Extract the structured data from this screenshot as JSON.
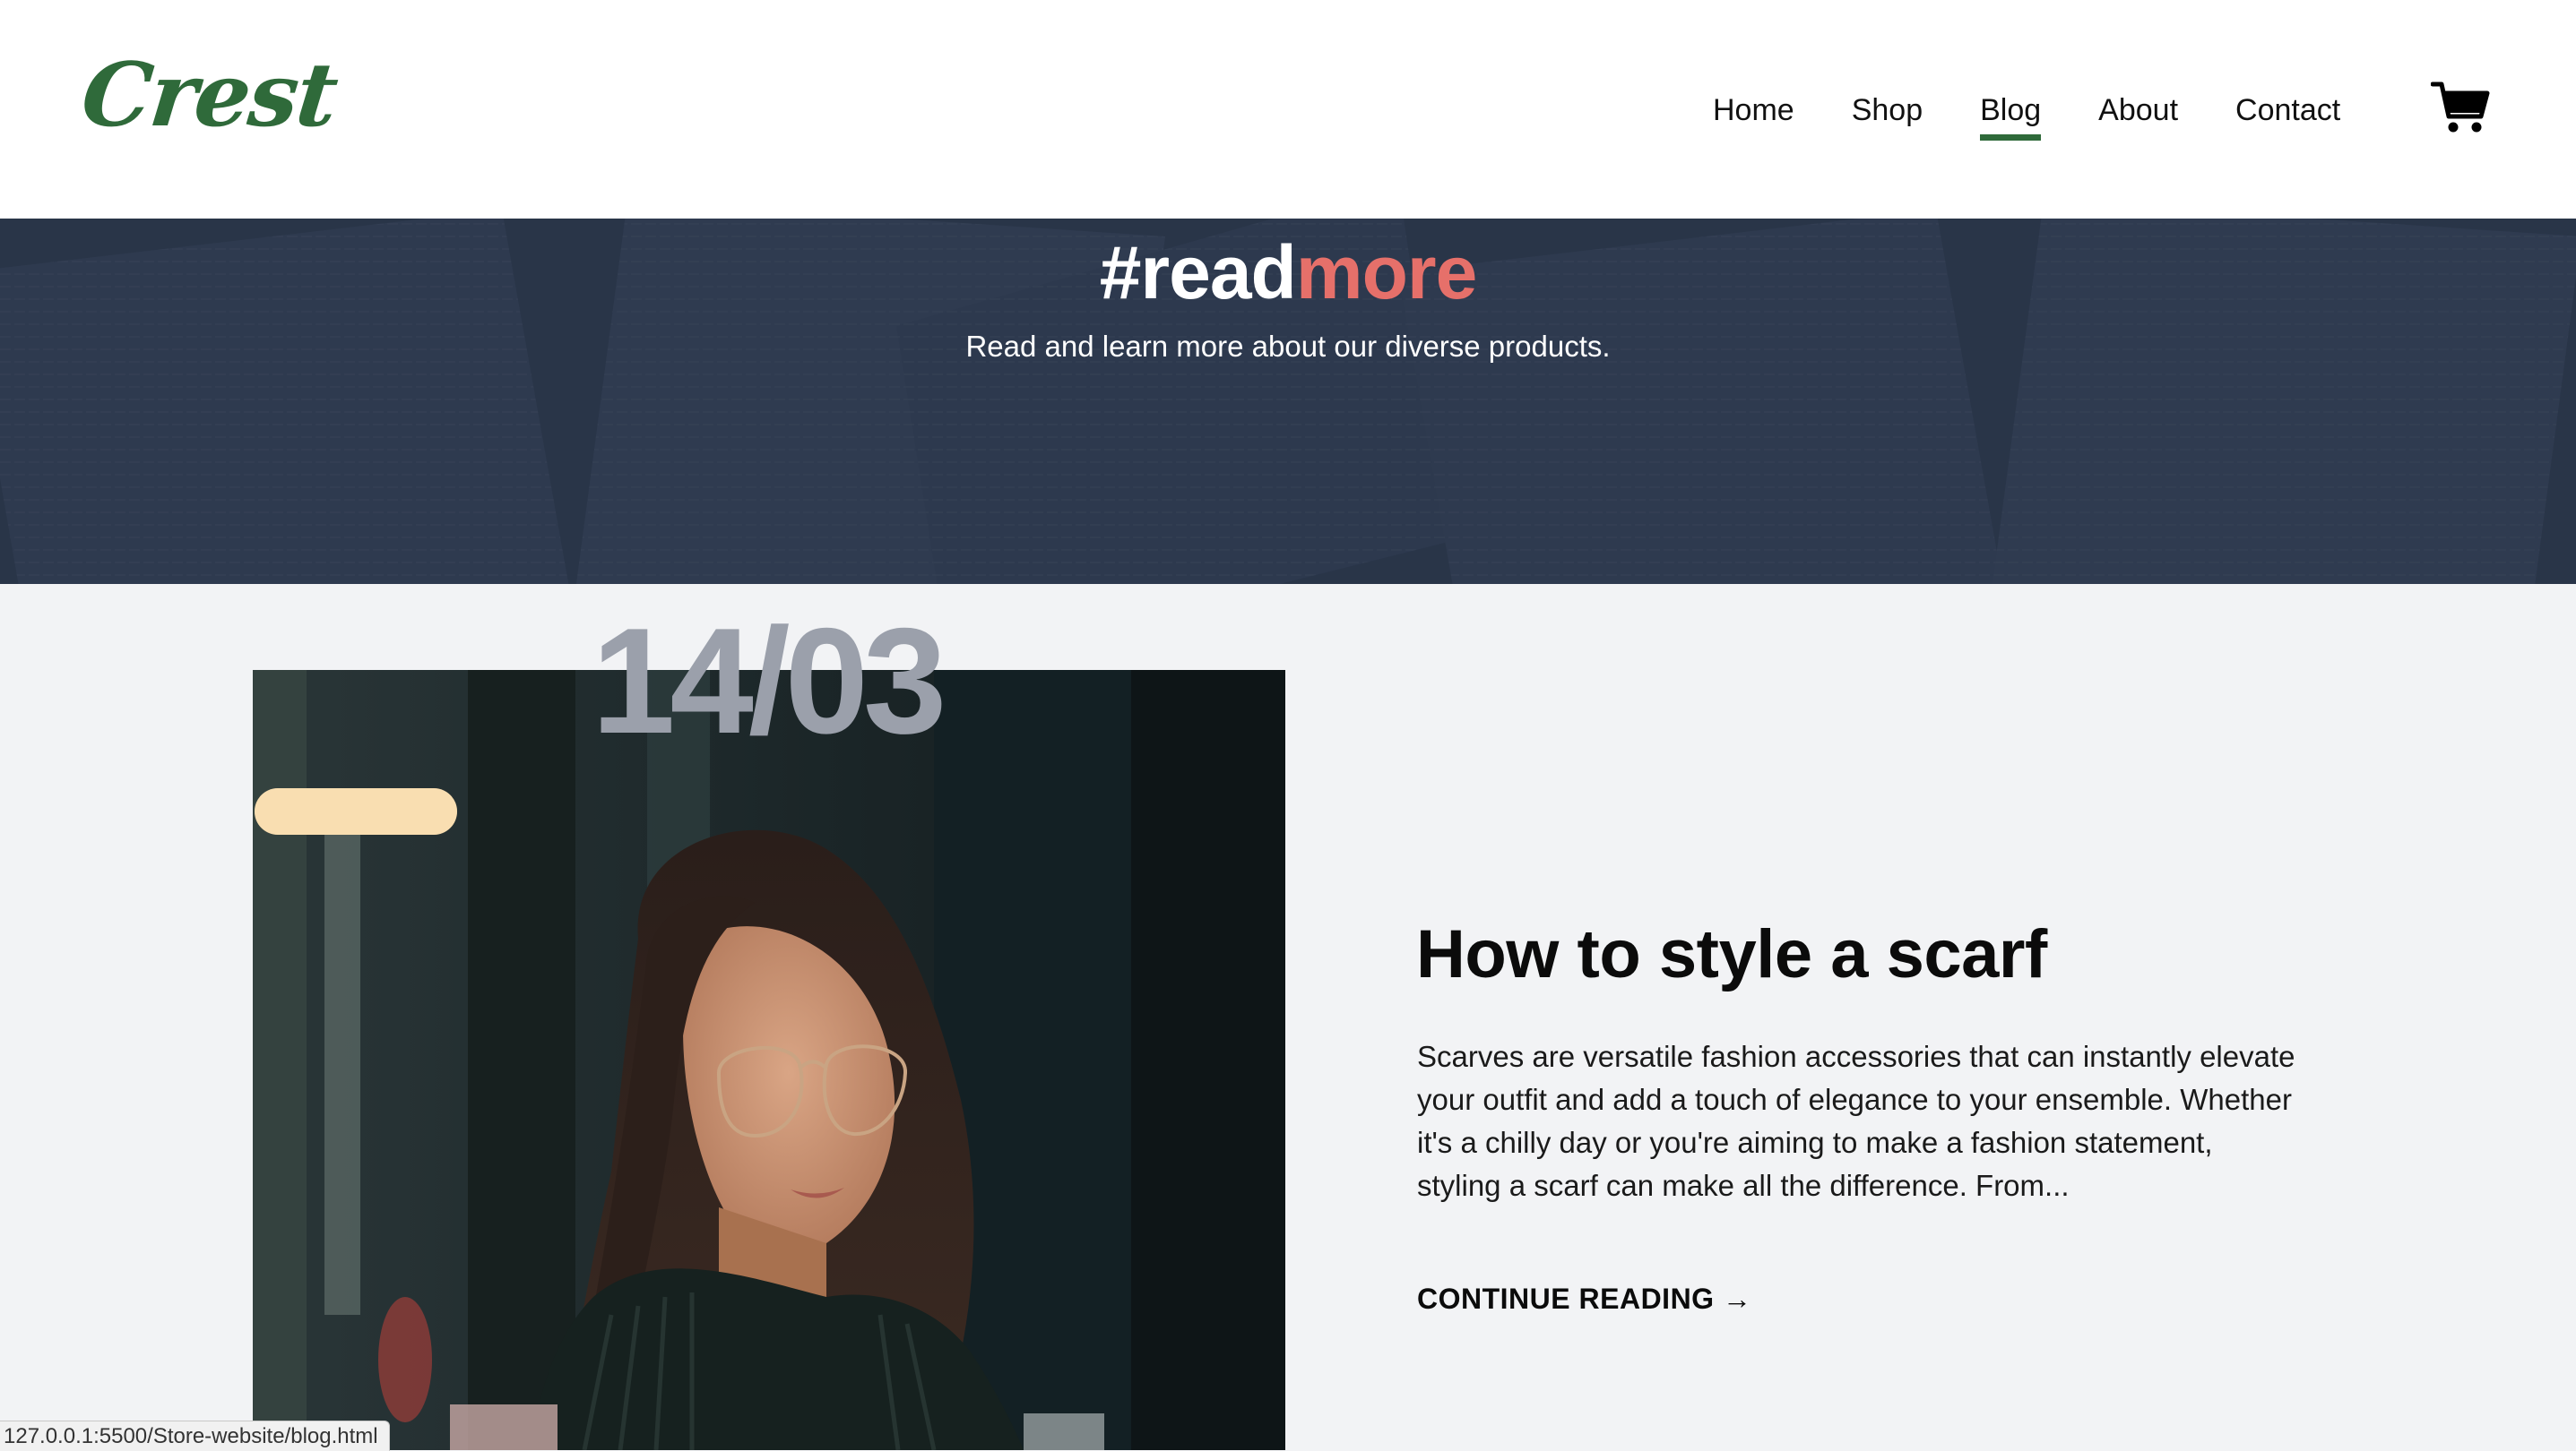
{
  "header": {
    "logo": "Crest",
    "nav": [
      {
        "label": "Home"
      },
      {
        "label": "Shop"
      },
      {
        "label": "Blog"
      },
      {
        "label": "About"
      },
      {
        "label": "Contact"
      }
    ],
    "active_nav": "Blog",
    "cart_icon": "cart-icon"
  },
  "hero": {
    "title_prefix": "#read",
    "title_accent": "more",
    "subtitle": "Read and learn more about our diverse products."
  },
  "post": {
    "date": "14/03",
    "title": "How to style a scarf",
    "excerpt": "Scarves are versatile fashion accessories that can instantly elevate your outfit and add a touch of elegance to your ensemble. Whether it's a chilly day or you're aiming to make a fashion statement, styling a scarf can make all the difference. From...",
    "continue_label": "CONTINUE READING →"
  },
  "status_bar": {
    "url": "127.0.0.1:5500/Store-website/blog.html"
  },
  "colors": {
    "brand_green": "#2f6a3a",
    "accent_coral": "#e6706a",
    "date_gray": "#9ba0ab",
    "page_bg": "#f2f3f5"
  }
}
